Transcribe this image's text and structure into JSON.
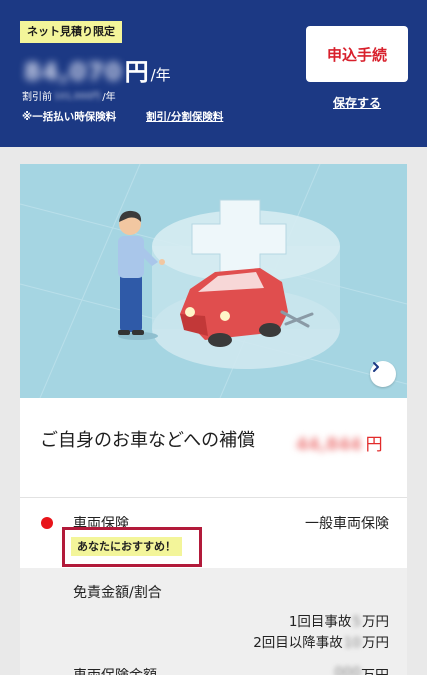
{
  "header": {
    "badge": "ネット見積り限定",
    "price_masked": "84,070",
    "price_unit": "円",
    "price_suffix": "/年",
    "before_label": "割引前",
    "before_masked": "101,000円",
    "before_suffix": "/年",
    "note": "※一括払い時保険料",
    "split_link": "割引/分割保険料",
    "apply_button": "申込手続",
    "save_link": "保存する"
  },
  "coverage": {
    "title": "ご自身のお車などへの補償",
    "price_masked": "44,844",
    "price_unit": "円"
  },
  "item": {
    "label": "車両保険",
    "value": "一般車両保険",
    "recommend_tag": "あなたにおすすめ！"
  },
  "detail": {
    "label": "免責金額/割合",
    "line1_prefix": "1回目事故",
    "line1_mask": "5",
    "line1_suffix": "万円",
    "line2_prefix": "2回目以降事故",
    "line2_mask": "10",
    "line2_suffix": "万円",
    "bottom_label": "車両保険金額",
    "bottom_mask": "000",
    "bottom_suffix": "万円"
  },
  "colors": {
    "header_bg": "#1c3984",
    "accent_red": "#d8202c",
    "badge_yellow": "#f3f59a",
    "hero_bg": "#a5d5e2",
    "highlight_border": "#b21a3a"
  },
  "icons": {
    "next": "chevron-right-icon",
    "dot": "red-dot-icon"
  }
}
